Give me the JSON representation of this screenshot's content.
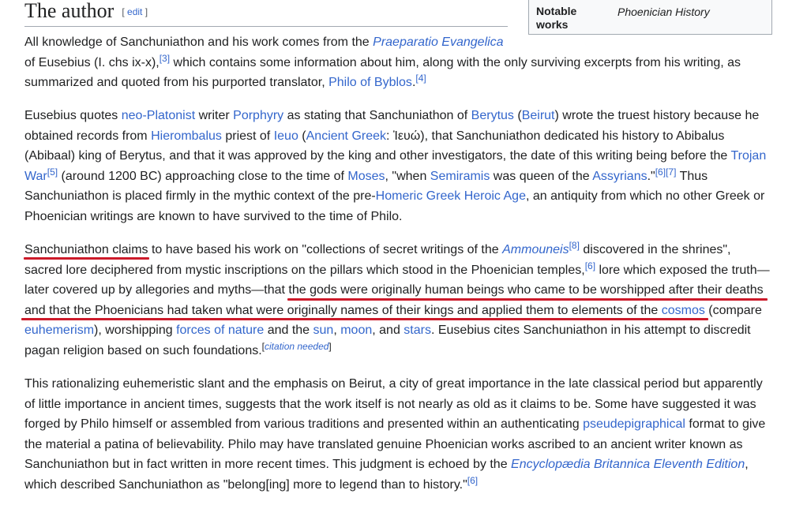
{
  "section": {
    "title": "The author",
    "edit_open": "[",
    "edit_label": "edit",
    "edit_close": "]"
  },
  "infobox": {
    "label": "Notable works",
    "value": "Phoenician History"
  },
  "p1": {
    "l1_a": "All knowledge of Sanchuniathon and his work comes from the ",
    "l1_link": "Praeparatio Evangelica",
    "l2_a": "of Eusebius (I. chs ix-x),",
    "ref3": "[3]",
    "l2_b": " which contains some information about him, along with the only surviving excerpts from his writing, as",
    "l3_a": "summarized and quoted from his purported translator, ",
    "l3_link": "Philo of Byblos",
    "l3_b": ".",
    "ref4": "[4]"
  },
  "p2": {
    "l1_a": "Eusebius quotes ",
    "l1_link1": "neo-Platonist",
    "l1_b": " writer ",
    "l1_link2": "Porphyry",
    "l1_c": " as stating that Sanchuniathon of ",
    "l1_link3": "Berytus",
    "l1_d": " (",
    "l1_link4": "Beirut",
    "l1_e": ") wrote the truest history because he",
    "l2_a": "obtained records from ",
    "l2_link1": "Hierombalus",
    "l2_b": " priest of ",
    "l2_link2": "Ieuo",
    "l2_c": " (",
    "l2_link3": "Ancient Greek",
    "l2_d": ": Ἰευώ), that Sanchuniathon dedicated his history to Abibalus",
    "l3_a": "(Abibaal) king of Berytus, and that it was approved by the king and other investigators, the date of this writing being before the ",
    "l3_link": "Trojan",
    "l4_link1": "War",
    "ref5": "[5]",
    "l4_a": " (around 1200 BC) approaching close to the time of ",
    "l4_link2": "Moses",
    "l4_b": ", \"when ",
    "l4_link3": "Semiramis",
    "l4_c": " was queen of the ",
    "l4_link4": "Assyrians",
    "l4_d": ".\"",
    "ref6": "[6]",
    "ref7": "[7]",
    "l4_e": " Thus",
    "l5_a": "Sanchuniathon is placed firmly in the mythic context of the pre-",
    "l5_link": "Homeric Greek Heroic Age",
    "l5_b": ", an antiquity from which no other Greek or",
    "l6_a": "Phoenician writings are known to have survived to the time of Philo."
  },
  "p3": {
    "l1_a": "Sanchuniathon claims to have based his work on \"collections of secret writings of the ",
    "l1_link": "Ammouneis",
    "ref8": "[8]",
    "l1_b": " discovered in the shrines\",",
    "l2_a": "sacred lore deciphered from mystic inscriptions on the pillars which stood in the Phoenician temples,",
    "ref6": "[6]",
    "l2_b": " lore which exposed the truth—",
    "l3_a": "later covered up by allegories and myths—that the gods were originally human beings who came to be worshipped after their deaths",
    "l4_a": "and that the Phoenicians had taken what were originally names of their kings and applied them to elements of the ",
    "l4_link": "cosmos",
    "l4_b": " (compare",
    "l5_link1": "euhemerism",
    "l5_a": "), worshipping ",
    "l5_link2": "forces of nature",
    "l5_b": " and the ",
    "l5_link3": "sun",
    "l5_c": ", ",
    "l5_link4": "moon",
    "l5_d": ", and ",
    "l5_link5": "stars",
    "l5_e": ". Eusebius cites Sanchuniathon in his attempt to discredit",
    "l6_a": "pagan religion based on such foundations.",
    "cn_open": "[",
    "cn_text": "citation needed",
    "cn_close": "]"
  },
  "p4": {
    "l1_a": "This rationalizing euhemeristic slant and the emphasis on Beirut, a city of great importance in the late classical period but apparently",
    "l2_a": "of little importance in ancient times, suggests that the work itself is not nearly as old as it claims to be. Some have suggested it was",
    "l3_a": "forged by Philo himself or assembled from various traditions and presented within an authenticating ",
    "l3_link": "pseudepigraphical",
    "l3_b": " format to give",
    "l4_a": "the material a patina of believability. Philo may have translated genuine Phoenician works ascribed to an ancient writer known as",
    "l5_a": "Sanchuniathon but in fact written in more recent times. This judgment is echoed by the ",
    "l5_link": "Encyclopædia Britannica Eleventh Edition",
    "l5_b": ",",
    "l6_a": "which described Sanchuniathon as \"belong[ing] more to legend than to history.\"",
    "ref6": "[6]"
  },
  "colors": {
    "link": "#3366cc",
    "text": "#202122",
    "underline_annotation": "#cc1a2a"
  }
}
